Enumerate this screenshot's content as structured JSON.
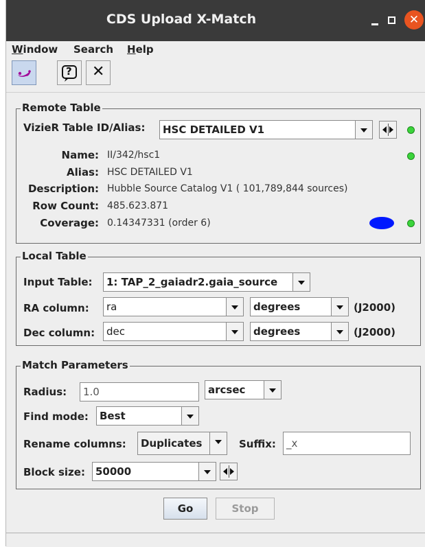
{
  "window": {
    "title": "CDS Upload X-Match"
  },
  "menu": [
    {
      "label": "Window",
      "mnemonic": "W"
    },
    {
      "label": "Search",
      "mnemonic": ""
    },
    {
      "label": "Help",
      "mnemonic": "H"
    }
  ],
  "toolbar": {
    "tools": [
      {
        "icon": "sampling-icon",
        "active": true
      },
      {
        "icon": "help-icon",
        "active": false
      },
      {
        "icon": "close-icon",
        "active": false
      }
    ],
    "help_glyph": "?",
    "close_glyph": "✕"
  },
  "remote": {
    "title": "Remote Table",
    "table_label": "VizieR Table ID/Alias:",
    "table_value": "HSC DETAILED V1",
    "name_label": "Name:",
    "name_value": "II/342/hsc1",
    "alias_label": "Alias:",
    "alias_value": "HSC DETAILED V1",
    "desc_label": "Description:",
    "desc_value": "Hubble Source Catalog V1 ( 101,789,844 sources)",
    "rows_label": "Row Count:",
    "rows_value": "485.623.871",
    "coverage_label": "Coverage:",
    "coverage_value": "0.14347331 (order 6)",
    "coverage_color": "#0018ff",
    "status_color": "#3bd43b"
  },
  "local": {
    "title": "Local Table",
    "input_label": "Input Table:",
    "input_value": "1: TAP_2_gaiadr2.gaia_source",
    "ra_label": "RA column:",
    "ra_value": "ra",
    "ra_unit": "degrees",
    "ra_system": "(J2000)",
    "dec_label": "Dec column:",
    "dec_value": "dec",
    "dec_unit": "degrees",
    "dec_system": "(J2000)"
  },
  "match": {
    "title": "Match Parameters",
    "radius_label": "Radius:",
    "radius_value": "1.0",
    "radius_unit": "arcsec",
    "find_label": "Find mode:",
    "find_value": "Best",
    "rename_label": "Rename columns:",
    "rename_value": "Duplicates",
    "suffix_label": "Suffix:",
    "suffix_value": "_x",
    "block_label": "Block size:",
    "block_value": "50000"
  },
  "actions": {
    "go": "Go",
    "stop": "Stop"
  }
}
